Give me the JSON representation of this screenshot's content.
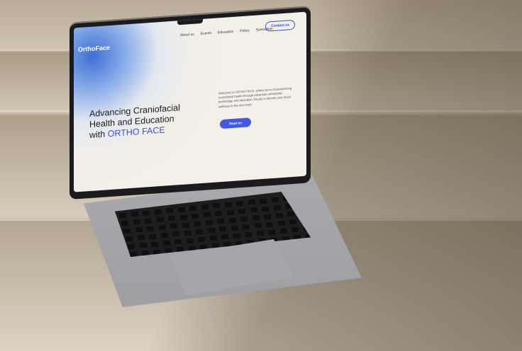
{
  "site": {
    "logo_dark": "Ortho",
    "logo_light": "Face",
    "nav": [
      "About us",
      "Events",
      "Education",
      "Policy",
      "Specialists"
    ],
    "contact_label": "Contact us",
    "hero_title_prefix": "Advancing Craniofacial Health and Education with",
    "hero_title_accent": "ORTHO FACE",
    "hero_text": "Welcome to ORTHO FACE, where we're revolutionizing craniofacial health through advanced orthodontic technology and education. Ready to elevate your facial wellness to the next level",
    "cta_label": "Read on"
  }
}
